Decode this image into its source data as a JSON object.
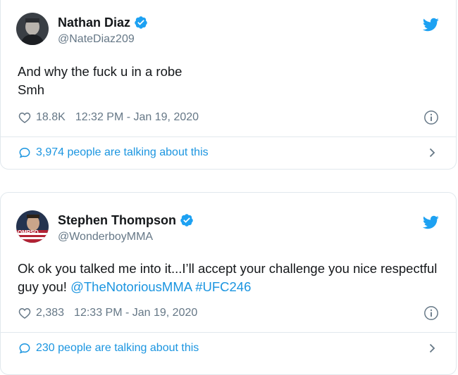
{
  "tweets": [
    {
      "author_name": "Nathan Diaz",
      "handle": "@NateDiaz209",
      "text": "And why the fuck u in a robe\nSmh",
      "likes": "18.8K",
      "timestamp": "12:32 PM - Jan 19, 2020",
      "talking": "3,974 people are talking about this",
      "avatar_icon": "avatar-photo"
    },
    {
      "author_name": "Stephen Thompson",
      "handle": "@WonderboyMMA",
      "text_plain": "Ok ok you talked me into it...I’ll accept your challenge you nice respectful guy you! ",
      "mention": "@TheNotoriousMMA",
      "hashtag": "#UFC246",
      "likes": "2,383",
      "timestamp": "12:33 PM - Jan 19, 2020",
      "talking": "230 people are talking about this",
      "avatar_text": "OMPSO"
    }
  ],
  "colors": {
    "link": "#1b95e0",
    "muted": "#657786",
    "border": "#e1e8ed",
    "verified": "#1da1f2"
  }
}
